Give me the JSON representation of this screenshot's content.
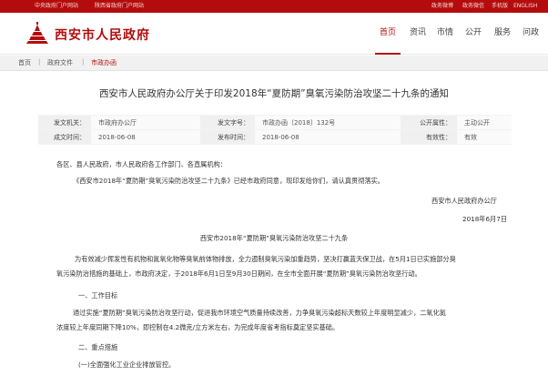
{
  "topbar": {
    "left_links": [
      "中央政府门户网站",
      "陕西省政府门户网站"
    ],
    "right_links": [
      "政务微博",
      "政务微信",
      "手机版",
      "ENGLISH"
    ]
  },
  "header": {
    "site_name": "西安市人民政府",
    "nav": [
      "首页",
      "资讯",
      "市情",
      "公开",
      "服务",
      "问政"
    ],
    "active_nav": "首页",
    "brand_color": "#b40c0c"
  },
  "breadcrumb": [
    "首页",
    "政府文件",
    "市政办函"
  ],
  "article": {
    "title": "西安市人民政府办公厅关于印发2018年“夏防期”臭氧污染防治攻坚二十九条的通知",
    "meta": {
      "row1": [
        {
          "label": "发文机关：",
          "value": "市政府办公厅"
        },
        {
          "label": "发文字号：",
          "value": "市政办函〔2018〕132号"
        },
        {
          "label": "公开属性：",
          "value": "主动公开"
        }
      ],
      "row2": [
        {
          "label": "成文时间：",
          "value": "2018-06-08"
        },
        {
          "label": "发布时间：",
          "value": "2018-06-08"
        },
        {
          "label": "有效性：",
          "value": "有效"
        }
      ]
    },
    "salutation": "各区、县人民政府，市人民政府各工作部门、各直属机构：",
    "intro": "《西安市2018年“夏防期”臭氧污染防治攻坚二十九条》已经市政府同意，现印发给你们，请认真贯彻落实。",
    "signature": "西安市人民政府办公厅",
    "date": "2018年6月7日",
    "subtitle": "西安市2018年“夏防期”臭氧污染防治攻坚二十九条",
    "para1_line1": "为有效减少挥发性有机物和氮氧化物等臭氧前体物排放，全力遏制臭氧污染加重趋势，坚决打赢蓝天保卫战，在5月1日已实施部分臭",
    "para1_line2": "氧污染防治措施的基础上，市政府决定，于2018年6月1日至9月30日期间，在全市全面开展“夏防期”臭氧污染防治攻坚行动。",
    "section1": "一、工作目标",
    "para2_line1": "通过实施“夏防期”臭氧污染防治攻坚行动，促进我市环境空气质量持续改善，力争臭氧污染超标天数较上年度明显减少，二氧化氮",
    "para2_line2": "浓度较上年度同期下降10%，即控制在4.2微克/立方米左右，为完成年度省考指标奠定坚实基础。",
    "section2": "二、重点措施",
    "item1": "(一)全面强化工业企业排放管控。"
  }
}
